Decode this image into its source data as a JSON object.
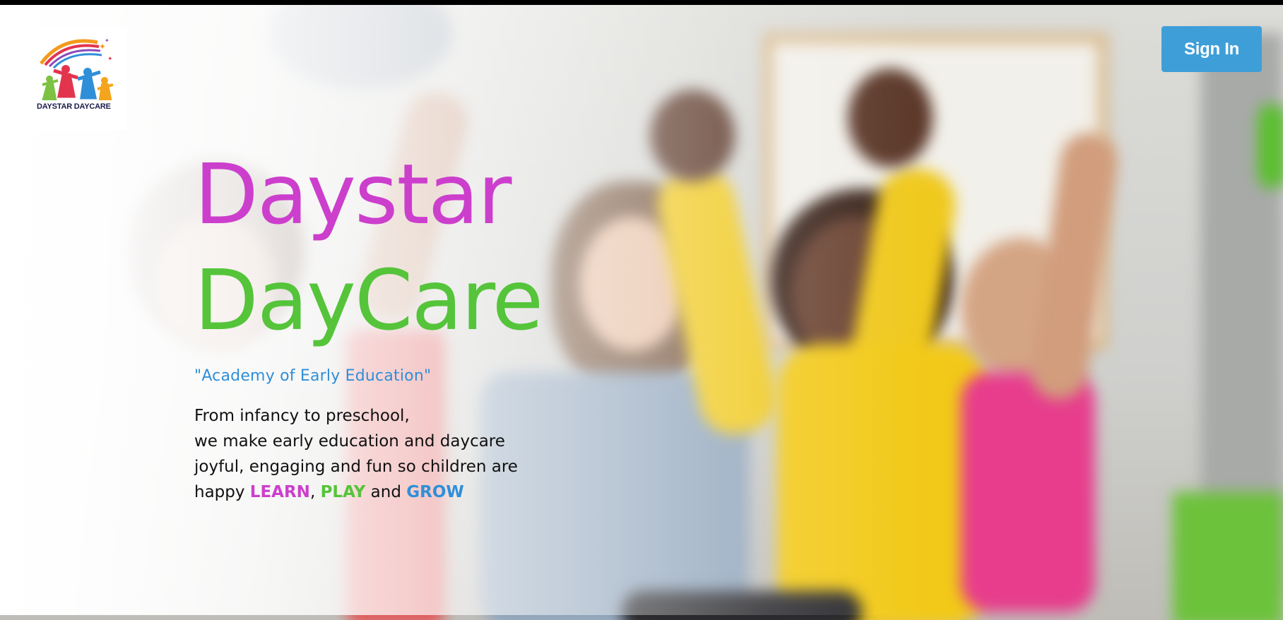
{
  "logo": {
    "text": "DAYSTAR DAYCARE",
    "icon": "daystar-children-rainbow-logo"
  },
  "header": {
    "sign_in_label": "Sign In"
  },
  "hero": {
    "title_line1": "Daystar",
    "title_line2": "DayCare",
    "tagline": "\"Academy of Early Education\"",
    "description": {
      "line1": "From infancy to preschool,",
      "line2": "we make early education and daycare",
      "line3": "joyful, engaging and fun so children are",
      "line4_prefix": "happy ",
      "learn": "LEARN",
      "comma": ", ",
      "play": "PLAY",
      "and": " and ",
      "grow": "GROW"
    }
  },
  "colors": {
    "brand_magenta": "#cc3fcc",
    "brand_green": "#55c43a",
    "brand_blue": "#2f8fd8",
    "button_blue": "#3e9fd8"
  }
}
